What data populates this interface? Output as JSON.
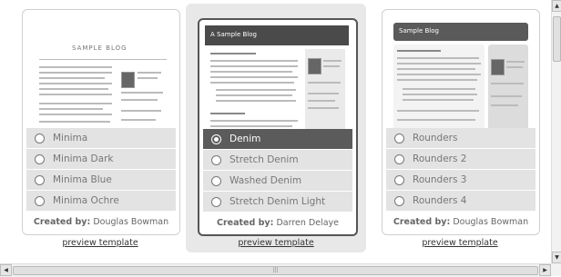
{
  "templates": [
    {
      "thumb_title": "SAMPLE BLOG",
      "options": [
        "Minima",
        "Minima Dark",
        "Minima Blue",
        "Minima Ochre"
      ],
      "selected_index": -1,
      "credit_label": "Created by:",
      "credit_name": "Douglas Bowman",
      "preview_label": "preview template"
    },
    {
      "thumb_title": "A Sample Blog",
      "options": [
        "Denim",
        "Stretch Denim",
        "Washed Denim",
        "Stretch Denim Light"
      ],
      "selected_index": 0,
      "credit_label": "Created by:",
      "credit_name": "Darren Delaye",
      "preview_label": "preview template"
    },
    {
      "thumb_title": "Sample Blog",
      "options": [
        "Rounders",
        "Rounders 2",
        "Rounders 3",
        "Rounders 4"
      ],
      "selected_index": -1,
      "credit_label": "Created by:",
      "credit_name": "Douglas Bowman",
      "preview_label": "preview template"
    }
  ],
  "scrollbars": {
    "up_arrow": "▲",
    "down_arrow": "▼",
    "left_arrow": "◀",
    "right_arrow": "▶",
    "grip": "|||"
  }
}
